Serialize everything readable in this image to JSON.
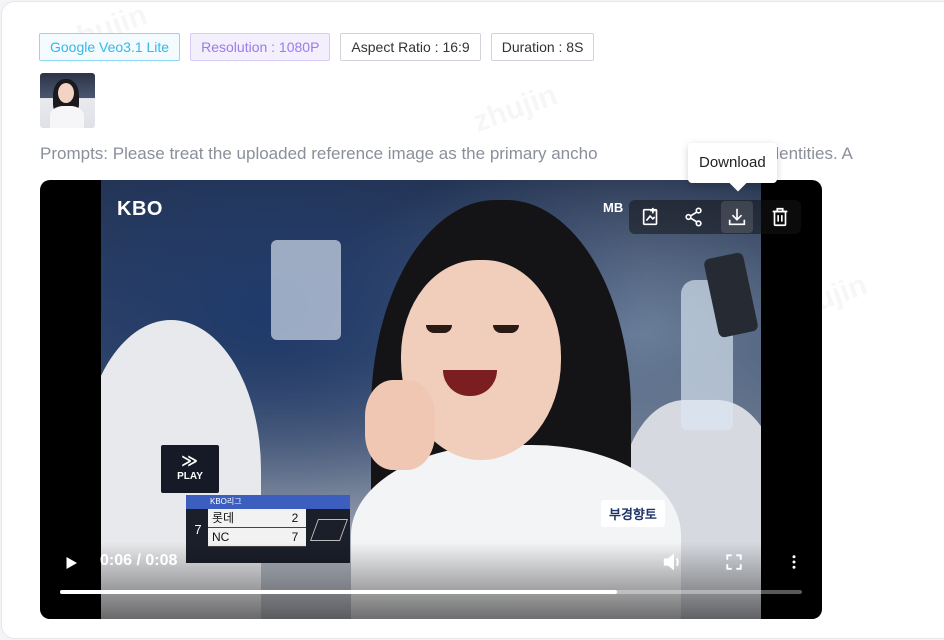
{
  "tags": [
    {
      "id": "model",
      "label": "Google Veo3.1 Lite"
    },
    {
      "id": "resolution",
      "label": "Resolution : 1080P"
    },
    {
      "id": "aspect",
      "label": "Aspect Ratio : 16:9"
    },
    {
      "id": "duration",
      "label": "Duration : 8S"
    }
  ],
  "prompt": {
    "text": "Prompts: Please treat the uploaded reference image as the primary ancho",
    "text_tail": "bjects' identities. A"
  },
  "video": {
    "broadcast_logo": "KBO",
    "channel_logo": "MB",
    "play_logo_mark": "≫",
    "play_logo_label": "PLAY",
    "jersey_text": "부경향토",
    "scoreboard": {
      "header": "KBO리그",
      "inning": "7",
      "teams": [
        {
          "name": "롯데",
          "score": "2"
        },
        {
          "name": "NC",
          "score": "7"
        }
      ]
    },
    "time_display": "0:06 / 0:08",
    "progress_fraction": 0.75
  },
  "toolbar": {
    "tooltip": "Download",
    "tools": [
      {
        "name": "image-edit-icon"
      },
      {
        "name": "share-icon"
      },
      {
        "name": "download-icon"
      },
      {
        "name": "trash-icon"
      }
    ]
  },
  "colors": {
    "model_tag": "#37b7e6",
    "resolution_tag": "#9b7ce8",
    "accent": "#ffffff"
  }
}
